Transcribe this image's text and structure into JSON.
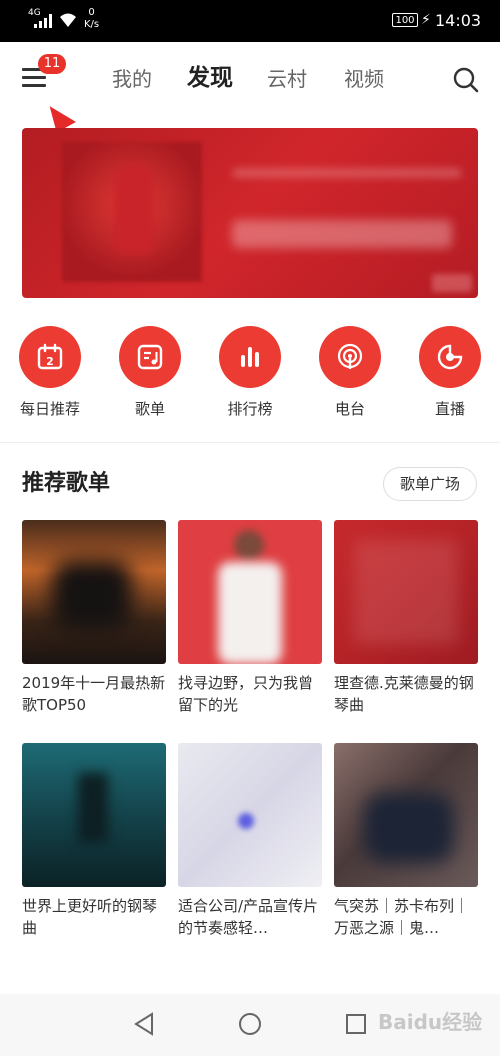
{
  "status_bar": {
    "network": "4G",
    "speed_value": "0",
    "speed_unit": "K/s",
    "battery": "100",
    "time": "14:03"
  },
  "top_nav": {
    "menu_badge": "11",
    "tabs": [
      {
        "label": "我的",
        "active": false
      },
      {
        "label": "发现",
        "active": true
      },
      {
        "label": "云村",
        "active": false
      },
      {
        "label": "视频",
        "active": false
      }
    ],
    "icons": {
      "menu": "hamburger-menu-icon",
      "search": "search-icon"
    }
  },
  "quick_entries": [
    {
      "label": "每日推荐",
      "icon": "calendar-icon",
      "calendar_day": "2"
    },
    {
      "label": "歌单",
      "icon": "playlist-icon"
    },
    {
      "label": "排行榜",
      "icon": "bar-chart-icon"
    },
    {
      "label": "电台",
      "icon": "radio-icon"
    },
    {
      "label": "直播",
      "icon": "live-icon"
    }
  ],
  "recommended": {
    "title": "推荐歌单",
    "plaza_button": "歌单广场",
    "playlists": [
      {
        "title": "2019年十一月最热新歌TOP50"
      },
      {
        "title": "找寻边野，只为我曾留下的光"
      },
      {
        "title": "理查德.克莱德曼的钢琴曲"
      },
      {
        "title": "世界上更好听的钢琴曲"
      },
      {
        "title": "适合公司/产品宣传片的节奏感轻…"
      },
      {
        "title": "气突苏｜苏卡布列｜万恶之源｜鬼…"
      }
    ]
  },
  "watermark": "Baidu经验",
  "colors": {
    "accent": "#ec3b33",
    "badge": "#e8322a"
  }
}
